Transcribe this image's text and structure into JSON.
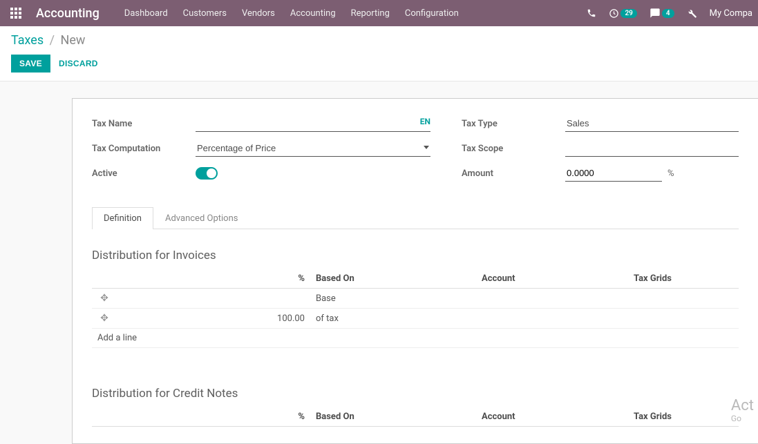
{
  "navbar": {
    "appTitle": "Accounting",
    "menu": [
      "Dashboard",
      "Customers",
      "Vendors",
      "Accounting",
      "Reporting",
      "Configuration"
    ],
    "clockBadge": "29",
    "chatBadge": "4",
    "companyName": "My Compa"
  },
  "breadcrumb": {
    "root": "Taxes",
    "current": "New"
  },
  "actions": {
    "save": "SAVE",
    "discard": "DISCARD"
  },
  "form": {
    "labels": {
      "taxName": "Tax Name",
      "taxComputation": "Tax Computation",
      "active": "Active",
      "taxType": "Tax Type",
      "taxScope": "Tax Scope",
      "amount": "Amount"
    },
    "values": {
      "taxName": "",
      "lang": "EN",
      "taxComputation": "Percentage of Price",
      "taxType": "Sales",
      "taxScope": "",
      "amount": "0.0000",
      "amountSuffix": "%"
    }
  },
  "tabs": {
    "definition": "Definition",
    "advanced": "Advanced Options"
  },
  "distInvoices": {
    "title": "Distribution for Invoices",
    "headers": {
      "pct": "%",
      "basedOn": "Based On",
      "account": "Account",
      "taxGrids": "Tax Grids"
    },
    "rows": [
      {
        "pct": "",
        "basedOn": "Base",
        "account": "",
        "taxGrids": ""
      },
      {
        "pct": "100.00",
        "basedOn": "of tax",
        "account": "",
        "taxGrids": ""
      }
    ],
    "addLine": "Add a line"
  },
  "distCredits": {
    "title": "Distribution for Credit Notes",
    "headers": {
      "pct": "%",
      "basedOn": "Based On",
      "account": "Account",
      "taxGrids": "Tax Grids"
    }
  },
  "watermark": {
    "title": "Act",
    "sub": "Go "
  }
}
